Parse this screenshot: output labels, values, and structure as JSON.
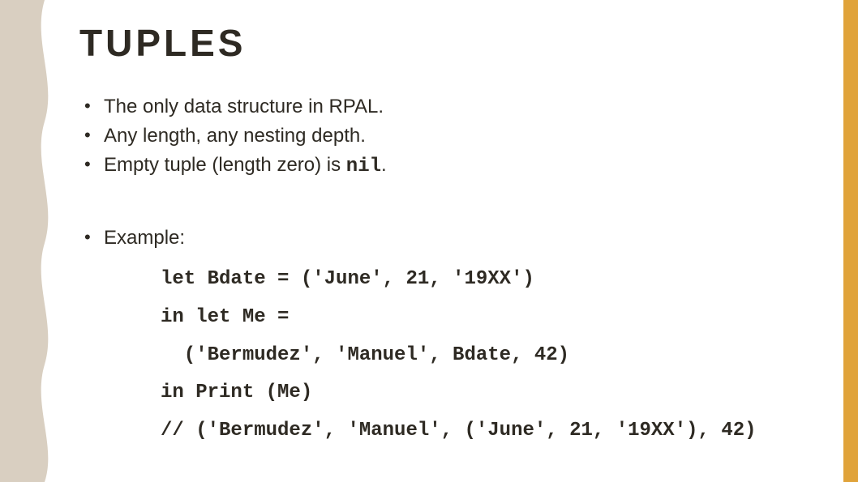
{
  "slide": {
    "title": "TUPLES",
    "bullet1": "The only data structure in RPAL.",
    "bullet2": "Any length, any nesting depth.",
    "bullet3_prefix": "Empty tuple (length zero) is ",
    "bullet3_code": "nil",
    "bullet3_suffix": ".",
    "bullet4": "Example:",
    "code": {
      "l1": "let Bdate = ('June', 21, '19XX')",
      "l2": "in let Me =",
      "l3": "  ('Bermudez', 'Manuel', Bdate, 42)",
      "l4": "in Print (Me)",
      "l5": "// ('Bermudez', 'Manuel', ('June', 21, '19XX'), 42)"
    }
  },
  "theme": {
    "accent": "#e0a33a",
    "wave": "#d9cfc1",
    "text": "#2e2a23"
  }
}
